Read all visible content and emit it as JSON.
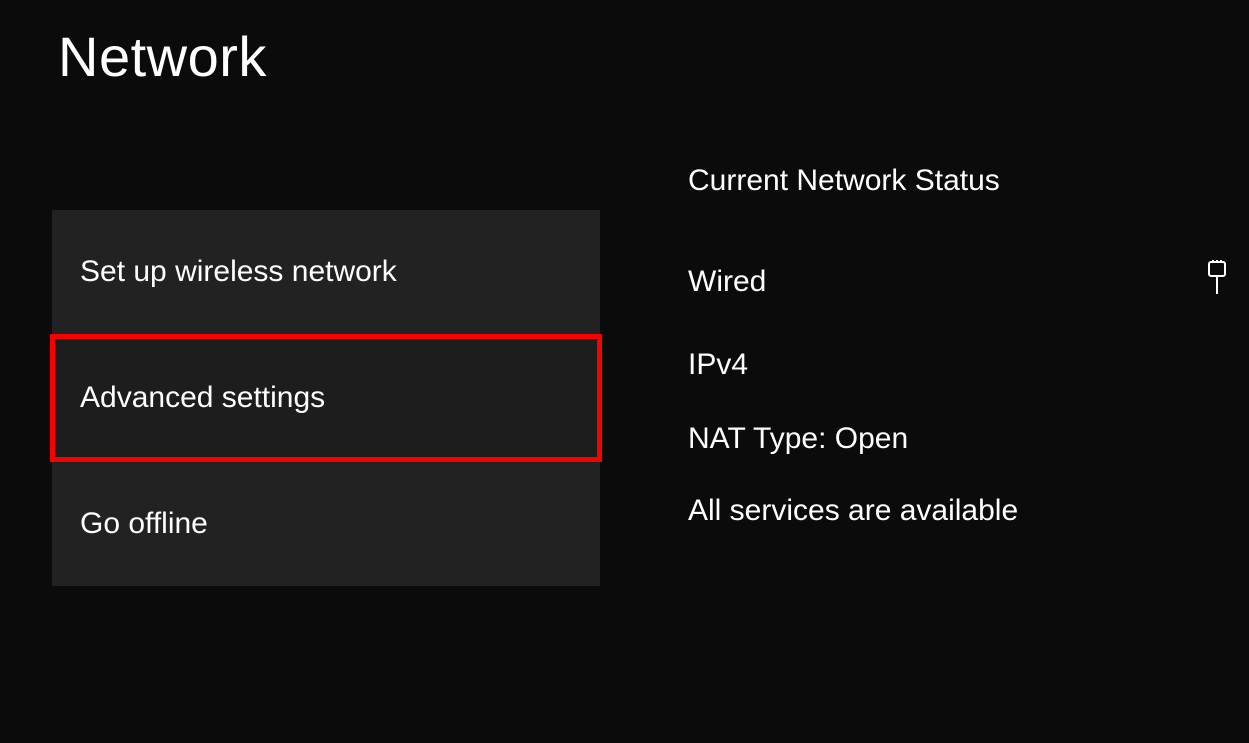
{
  "title": "Network",
  "menu": {
    "items": [
      {
        "label": "Set up wireless network",
        "highlight": false
      },
      {
        "label": "Advanced settings",
        "highlight": true
      },
      {
        "label": "Go offline",
        "highlight": false
      }
    ]
  },
  "status": {
    "heading": "Current Network Status",
    "connection_type": "Wired",
    "ip_version": "IPv4",
    "nat_line": "NAT Type: Open",
    "services_line": "All services are available"
  }
}
